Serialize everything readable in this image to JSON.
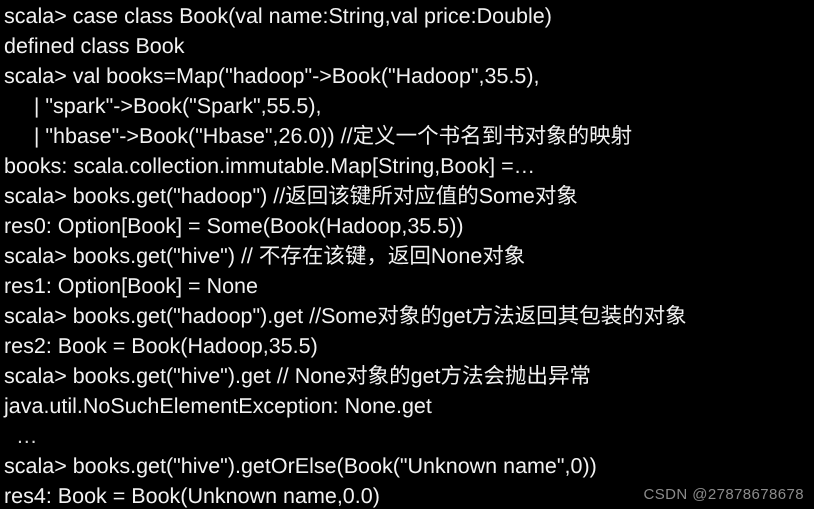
{
  "terminal": {
    "background_color": "#000000",
    "text_color": "#f2f2f2",
    "prompt": "scala>",
    "lines": [
      {
        "text": "scala> case class Book(val name:String,val price:Double)",
        "kind": "input"
      },
      {
        "text": "defined class Book",
        "kind": "output"
      },
      {
        "text": "scala> val books=Map(\"hadoop\"->Book(\"Hadoop\",35.5),",
        "kind": "input"
      },
      {
        "text": "     | \"spark\"->Book(\"Spark\",55.5),",
        "kind": "continuation"
      },
      {
        "text": "     | \"hbase\"->Book(\"Hbase\",26.0)) //定义一个书名到书对象的映射",
        "kind": "continuation"
      },
      {
        "text": "books: scala.collection.immutable.Map[String,Book] =…",
        "kind": "output"
      },
      {
        "text": "scala> books.get(\"hadoop\") //返回该键所对应值的Some对象",
        "kind": "input"
      },
      {
        "text": "res0: Option[Book] = Some(Book(Hadoop,35.5))",
        "kind": "output"
      },
      {
        "text": "scala> books.get(\"hive\") // 不存在该键，返回None对象",
        "kind": "input"
      },
      {
        "text": "res1: Option[Book] = None",
        "kind": "output"
      },
      {
        "text": "scala> books.get(\"hadoop\").get //Some对象的get方法返回其包装的对象",
        "kind": "input"
      },
      {
        "text": "res2: Book = Book(Hadoop,35.5)",
        "kind": "output"
      },
      {
        "text": "scala> books.get(\"hive\").get // None对象的get方法会抛出异常",
        "kind": "input"
      },
      {
        "text": "java.util.NoSuchElementException: None.get",
        "kind": "output"
      },
      {
        "text": "  …",
        "kind": "ellipsis"
      },
      {
        "text": "scala> books.get(\"hive\").getOrElse(Book(\"Unknown name\",0))",
        "kind": "input"
      },
      {
        "text": "res4: Book = Book(Unknown name,0.0)",
        "kind": "output"
      }
    ]
  },
  "watermark": {
    "text": "CSDN @27878678678",
    "color": "#8c8c8c"
  }
}
